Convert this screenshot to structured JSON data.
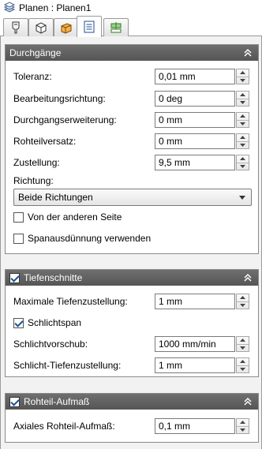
{
  "window": {
    "title": "Planen : Planen1",
    "title_icon": "layers-icon"
  },
  "tabs": [
    {
      "icon": "tool-icon",
      "active": false
    },
    {
      "icon": "cube-outline-icon",
      "active": false
    },
    {
      "icon": "stock-box-icon",
      "active": false
    },
    {
      "icon": "passes-list-icon",
      "active": true
    },
    {
      "icon": "linking-icon",
      "active": false
    }
  ],
  "section_passes": {
    "title": "Durchgänge",
    "tolerance": {
      "label": "Toleranz:",
      "value": "0,01 mm"
    },
    "machining_direction": {
      "label": "Bearbeitungsrichtung:",
      "value": "0 deg"
    },
    "pass_extension": {
      "label": "Durchgangserweiterung:",
      "value": "0 mm"
    },
    "stock_offset": {
      "label": "Rohteilversatz:",
      "value": "0 mm"
    },
    "stepover": {
      "label": "Zustellung:",
      "value": "9,5 mm"
    },
    "direction": {
      "label": "Richtung:",
      "selected": "Beide Richtungen"
    },
    "other_side": {
      "label": "Von der anderen Seite",
      "checked": false
    },
    "chip_thinning": {
      "label": "Spanausdünnung verwenden",
      "checked": false
    }
  },
  "section_depth": {
    "title": "Tiefenschnitte",
    "enabled": true,
    "max_stepdown": {
      "label": "Maximale Tiefenzustellung:",
      "value": "1 mm"
    },
    "finishing": {
      "label": "Schlichtspan",
      "checked": true
    },
    "finishing_feed": {
      "label": "Schlichtvorschub:",
      "value": "1000 mm/min"
    },
    "finishing_stepdown": {
      "label": "Schlicht-Tiefenzustellung:",
      "value": "1 mm"
    }
  },
  "section_stock": {
    "title": "Rohteil-Aufmaß",
    "enabled": true,
    "axial_stock": {
      "label": "Axiales Rohteil-Aufmaß:",
      "value": "0,1 mm"
    }
  },
  "colors": {
    "header_bg": "#5f5f5f",
    "check_mark": "#1d4f91",
    "pane_bg": "#f2f2f2"
  }
}
